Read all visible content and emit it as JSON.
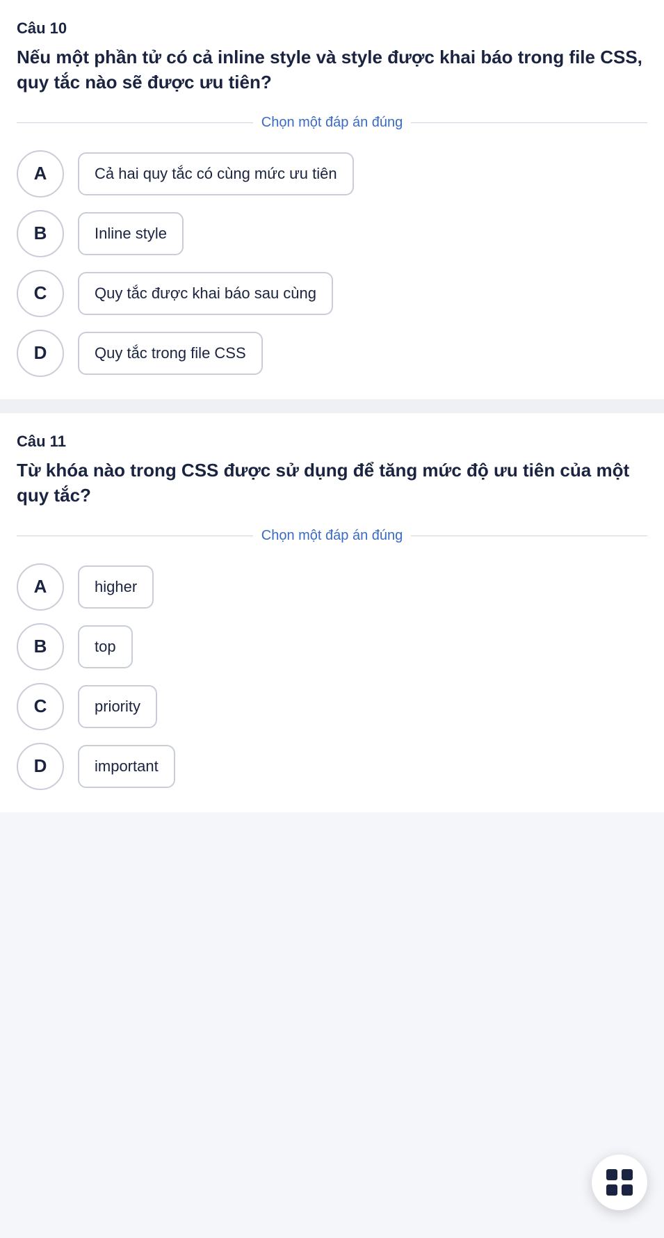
{
  "q10": {
    "number": "Câu 10",
    "text": "Nếu một phần tử có cả inline style và style được khai báo trong file CSS, quy tắc nào sẽ được ưu tiên?",
    "divider": "Chọn một đáp án đúng",
    "options": [
      {
        "letter": "A",
        "text": "Cả hai quy tắc có cùng mức ưu tiên"
      },
      {
        "letter": "B",
        "text": "Inline style"
      },
      {
        "letter": "C",
        "text": "Quy tắc được khai báo sau cùng"
      },
      {
        "letter": "D",
        "text": "Quy tắc trong file CSS"
      }
    ]
  },
  "q11": {
    "number": "Câu 11",
    "text": "Từ khóa nào trong CSS được sử dụng để tăng mức độ ưu tiên của một quy tắc?",
    "divider": "Chọn một đáp án đúng",
    "options": [
      {
        "letter": "A",
        "text": "higher"
      },
      {
        "letter": "B",
        "text": "top"
      },
      {
        "letter": "C",
        "text": "priority"
      },
      {
        "letter": "D",
        "text": "important"
      }
    ]
  },
  "fab": {
    "label": "grid-menu"
  }
}
